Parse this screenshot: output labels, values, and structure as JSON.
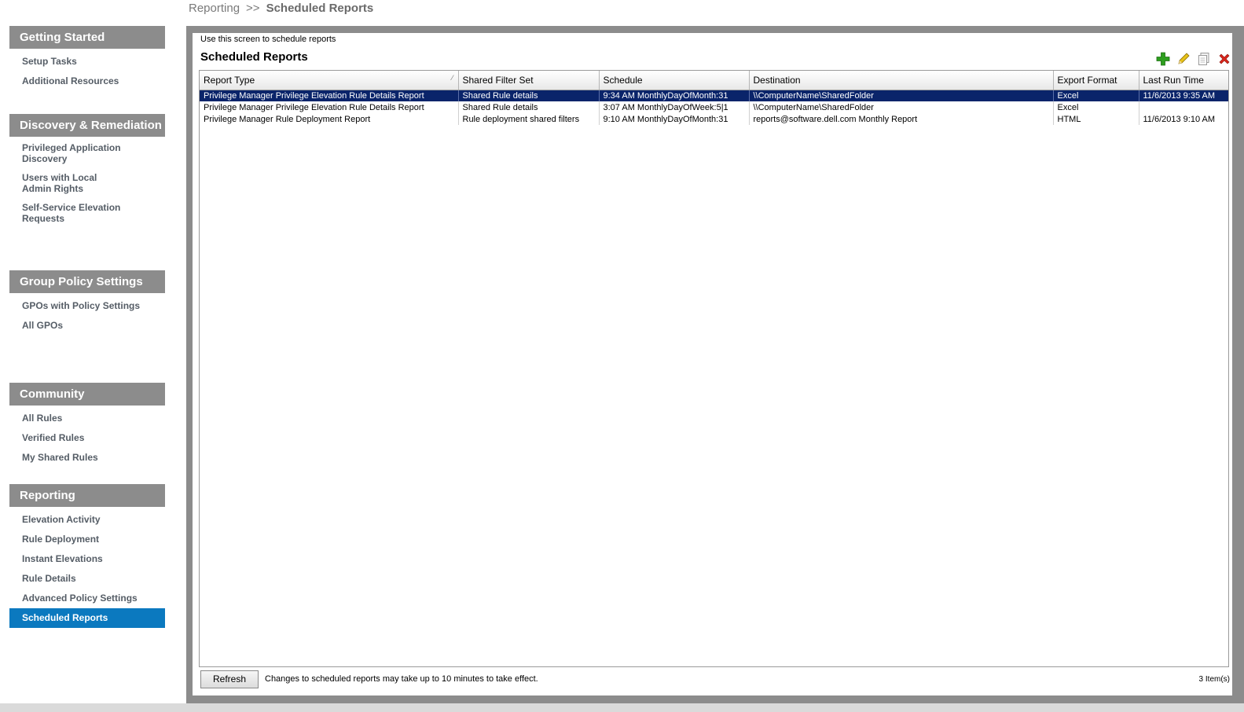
{
  "breadcrumb": {
    "parent": "Reporting",
    "separator": ">>",
    "current": "Scheduled Reports"
  },
  "sidebar": {
    "sections": [
      {
        "title": "Getting Started",
        "items": [
          "Setup Tasks",
          "Additional Resources"
        ]
      },
      {
        "title": "Discovery & Remediation",
        "items": [
          "Privileged Application Discovery",
          "Users with Local Admin Rights",
          "Self-Service Elevation Requests"
        ]
      },
      {
        "title": "Group Policy Settings",
        "items": [
          "GPOs with Policy Settings",
          "All GPOs"
        ]
      },
      {
        "title": "Community",
        "items": [
          "All Rules",
          "Verified Rules",
          "My Shared Rules"
        ]
      },
      {
        "title": "Reporting",
        "items": [
          "Elevation Activity",
          "Rule Deployment",
          "Instant Elevations",
          "Rule Details",
          "Advanced Policy Settings",
          "Scheduled Reports"
        ]
      }
    ],
    "active_item": "Scheduled Reports"
  },
  "panel": {
    "intro": "Use this screen to schedule reports",
    "title": "Scheduled Reports",
    "toolbar": {
      "add_icon": "add-icon",
      "edit_icon": "edit-icon",
      "copy_icon": "copy-icon",
      "delete_icon": "delete-icon"
    }
  },
  "table": {
    "columns": [
      "Report Type",
      "Shared Filter Set",
      "Schedule",
      "Destination",
      "Export Format",
      "Last Run Time"
    ],
    "rows": [
      [
        "Privilege Manager Privilege Elevation Rule Details Report",
        "Shared Rule details",
        "9:34 AM MonthlyDayOfMonth:31",
        "\\\\ComputerName\\SharedFolder",
        "Excel",
        "11/6/2013 9:35 AM"
      ],
      [
        "Privilege Manager Privilege Elevation Rule Details Report",
        "Shared Rule details",
        "3:07 AM MonthlyDayOfWeek:5|1",
        "\\\\ComputerName\\SharedFolder",
        "Excel",
        ""
      ],
      [
        "Privilege Manager Rule Deployment Report",
        "Rule deployment shared filters",
        "9:10 AM MonthlyDayOfMonth:31",
        "reports@software.dell.com Monthly Report",
        "HTML",
        "11/6/2013 9:10 AM"
      ]
    ],
    "selected_row": 0
  },
  "footer": {
    "refresh_label": "Refresh",
    "note": "Changes to scheduled reports may take up to 10 minutes to take effect.",
    "item_count": "3 Item(s)"
  },
  "colors": {
    "section_header": "#8c8c8c",
    "active_nav": "#0b79bf",
    "selected_row": "#0a246a",
    "add": "#2e9e1f",
    "delete": "#d9261c"
  }
}
